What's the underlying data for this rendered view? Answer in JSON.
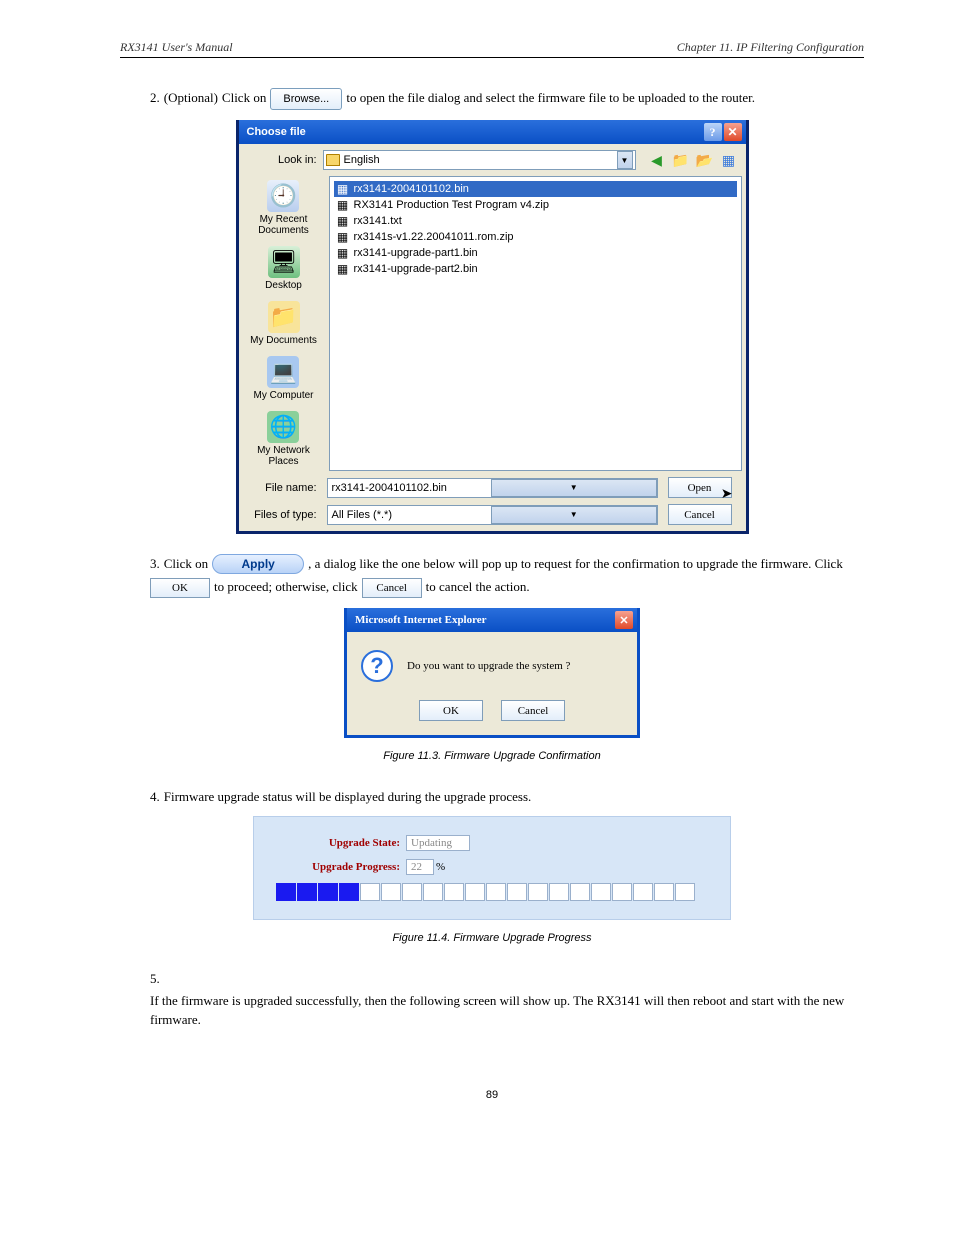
{
  "header": {
    "left": "RX3141 User's Manual",
    "right": "Chapter 11. IP Filtering Configuration"
  },
  "step2": {
    "prefix": "2.",
    "t1": "Click on ",
    "browse": "Browse...",
    "t2": " to open the file dialog and select the firmware file to be uploaded to the router.",
    "t3": "(Optional) "
  },
  "dialog": {
    "title": "Choose file",
    "lookin_label": "Look in:",
    "lookin_value": "English",
    "places": [
      {
        "label": "My Recent\nDocuments"
      },
      {
        "label": "Desktop"
      },
      {
        "label": "My Documents"
      },
      {
        "label": "My Computer"
      },
      {
        "label": "My Network\nPlaces"
      }
    ],
    "files": [
      {
        "name": "rx3141-2004101102.bin",
        "selected": true
      },
      {
        "name": "RX3141 Production Test Program v4.zip"
      },
      {
        "name": "rx3141.txt"
      },
      {
        "name": "rx3141s-v1.22.20041011.rom.zip"
      },
      {
        "name": "rx3141-upgrade-part1.bin"
      },
      {
        "name": "rx3141-upgrade-part2.bin"
      }
    ],
    "filename_label": "File name:",
    "filename_value": "rx3141-2004101102.bin",
    "filetype_label": "Files of type:",
    "filetype_value": "All Files (*.*)",
    "open": "Open",
    "cancel": "Cancel"
  },
  "step3": {
    "prefix": "3.",
    "t1": "Click on ",
    "apply": "Apply",
    "t2": ", a dialog like the one below will pop up to request for the confirmation to upgrade the firmware. Click ",
    "ok": "OK",
    "t3": " to proceed; otherwise, click ",
    "cancel": "Cancel",
    "t4": " to cancel the action."
  },
  "ie_dialog": {
    "title": "Microsoft Internet Explorer",
    "msg": "Do you want to upgrade the system ?",
    "ok": "OK",
    "cancel": "Cancel"
  },
  "caption1": "Figure 11.3. Firmware Upgrade Confirmation",
  "step4": {
    "prefix": "4.",
    "text": "Firmware upgrade status will be displayed during the upgrade process."
  },
  "progress": {
    "state_label": "Upgrade State:",
    "state_value": "Updating",
    "progress_label": "Upgrade Progress:",
    "progress_value": "22",
    "progress_unit": "%",
    "filled": 4,
    "total": 20
  },
  "caption2": "Figure 11.4. Firmware Upgrade Progress",
  "step5": {
    "prefix": "5.",
    "text": "If the firmware is upgraded successfully, then the following screen will show up. The RX3141 will then reboot and start with the new firmware."
  },
  "page_no": "89"
}
